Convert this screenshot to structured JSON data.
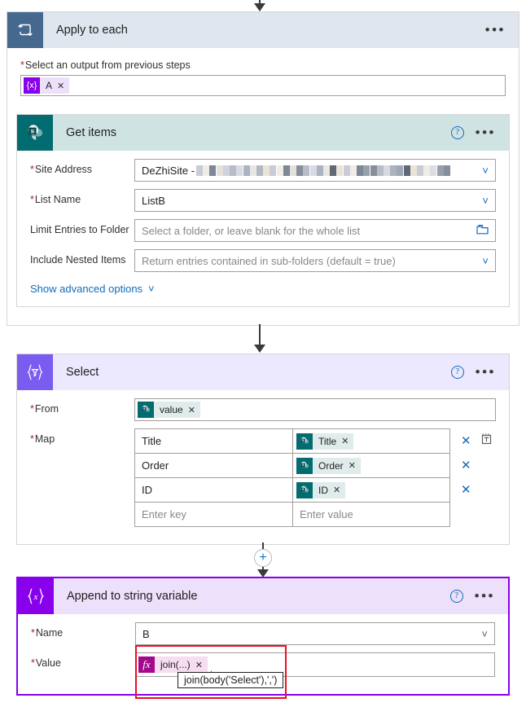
{
  "flow": {
    "scope": {
      "title": "Apply to each",
      "icon": "loop-icon",
      "menu_label": "•••",
      "input_label": "Select an output from previous steps",
      "input_token": {
        "icon": "{x}",
        "text": "A",
        "remove": "✕"
      }
    },
    "get_items": {
      "title": "Get items",
      "icon": "sharepoint-icon",
      "help_label": "?",
      "menu_label": "•••",
      "fields": [
        {
          "label": "Site Address",
          "required": true,
          "value": "DeZhiSite -",
          "redacted": true,
          "control": "dropdown"
        },
        {
          "label": "List Name",
          "required": true,
          "value": "ListB",
          "control": "dropdown"
        },
        {
          "label": "Limit Entries to Folder",
          "required": false,
          "placeholder": "Select a folder, or leave blank for the whole list",
          "control": "folder-picker"
        },
        {
          "label": "Include Nested Items",
          "required": false,
          "placeholder": "Return entries contained in sub-folders (default = true)",
          "control": "dropdown"
        }
      ],
      "advanced_link": "Show advanced options"
    },
    "select": {
      "title": "Select",
      "icon": "{▽}",
      "help_label": "?",
      "menu_label": "•••",
      "from_label": "From",
      "from_token": {
        "icon": "sharepoint-icon",
        "text": "value",
        "remove": "✕"
      },
      "map_label": "Map",
      "map_rows": [
        {
          "key": "Title",
          "value_token": "Title",
          "remove": "✕",
          "has_text_mode": true
        },
        {
          "key": "Order",
          "value_token": "Order",
          "remove": "✕",
          "has_text_mode": false
        },
        {
          "key": "ID",
          "value_token": "ID",
          "remove": "✕",
          "has_text_mode": false
        }
      ],
      "empty_row": {
        "key_placeholder": "Enter key",
        "value_placeholder": "Enter value"
      }
    },
    "insert_button": {
      "label": "+",
      "name": "insert-new-step"
    },
    "append": {
      "title": "Append to string variable",
      "icon": "{x}",
      "help_label": "?",
      "menu_label": "•••",
      "name_label": "Name",
      "name_value": "B",
      "value_label": "Value",
      "value_token": {
        "icon": "fx",
        "text": "join(...)",
        "remove": "✕"
      },
      "trailing_text": ",",
      "tooltip": "join(body('Select'),',')"
    }
  },
  "colors": {
    "scope_header": "#dfe6ef",
    "scope_icon": "#44688e",
    "sharepoint_teal": "#036c70",
    "sharepoint_header": "#cfe3e2",
    "select_purple": "#7a5cf0",
    "select_header": "#ece8fd",
    "variable_purple": "#8800ec",
    "variable_header": "#ece0fb",
    "fx_magenta": "#a4088c",
    "link_blue": "#0f6cbd",
    "required_red": "#a4262c",
    "highlight_red": "#e81123"
  }
}
